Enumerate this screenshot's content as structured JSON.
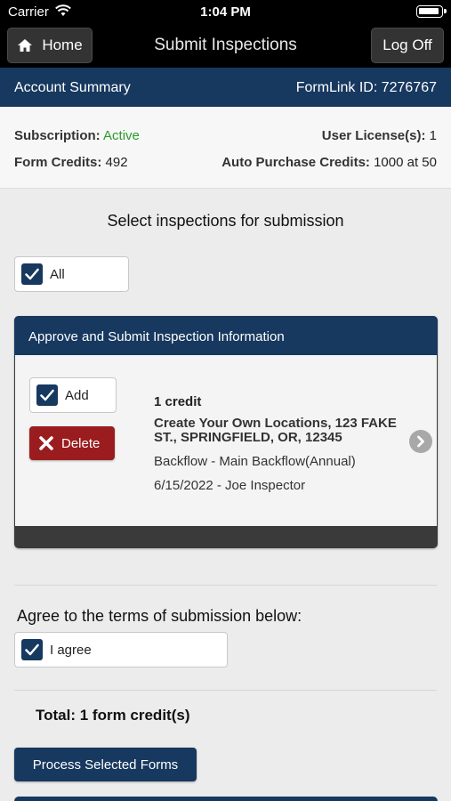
{
  "status_bar": {
    "carrier": "Carrier",
    "time": "1:04 PM"
  },
  "navbar": {
    "home_label": "Home",
    "title": "Submit Inspections",
    "logoff_label": "Log Off"
  },
  "account": {
    "label": "Account Summary",
    "formlink": "FormLink ID: 7276767"
  },
  "summary": {
    "subscription_label": "Subscription:",
    "subscription_value": "Active",
    "user_licenses_label": "User License(s):",
    "user_licenses_value": "1",
    "form_credits_label": "Form Credits:",
    "form_credits_value": "492",
    "auto_purchase_label": "Auto Purchase Credits:",
    "auto_purchase_value": "1000 at 50"
  },
  "select": {
    "heading": "Select inspections for submission",
    "all_label": "All",
    "all_checked": true
  },
  "panel": {
    "header": "Approve and Submit Inspection Information",
    "add_label": "Add",
    "add_checked": true,
    "delete_label": "Delete",
    "credit": "1 credit",
    "location": "Create Your Own Locations, 123 FAKE ST., SPRINGFIELD, OR, 12345",
    "type": "Backflow - Main Backflow(Annual)",
    "date_inspector": "6/15/2022 - Joe Inspector"
  },
  "terms": {
    "heading": "Agree to the terms of submission below:",
    "agree_label": "I agree",
    "agree_checked": true
  },
  "total": "Total: 1 form credit(s)",
  "process_label": "Process Selected Forms",
  "colors": {
    "brand_navy": "#17385f",
    "active_green": "#2a9b2a",
    "delete_red": "#9b1c1e"
  }
}
